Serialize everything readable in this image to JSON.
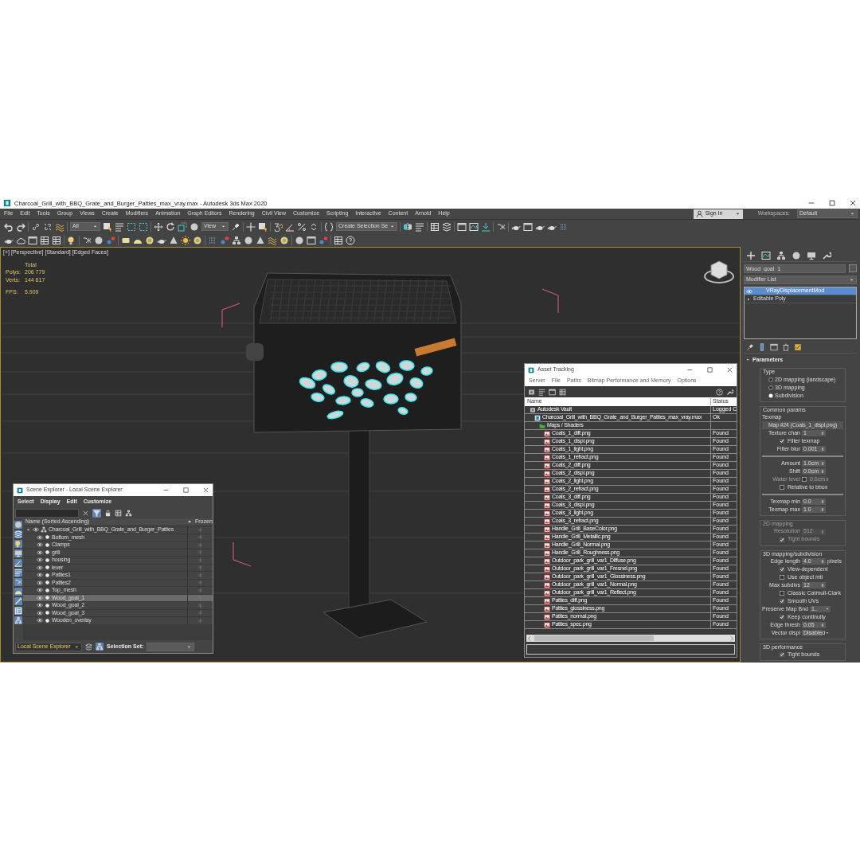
{
  "window": {
    "title": "Charcoal_Grill_with_BBQ_Grate_and_Burger_Patties_max_vray.max - Autodesk 3ds Max 2020"
  },
  "menu": [
    "File",
    "Edit",
    "Tools",
    "Group",
    "Views",
    "Create",
    "Modifiers",
    "Animation",
    "Graph Editors",
    "Rendering",
    "Civil View",
    "Customize",
    "Scripting",
    "Interactive",
    "Content",
    "Arnold",
    "Help"
  ],
  "sign_in": {
    "label": "Sign In"
  },
  "workspaces": {
    "label": "Workspaces:",
    "value": "Default"
  },
  "toolbar": {
    "selection_filter": "All",
    "reference_coord": "View",
    "named_selection": "Create Selection Se"
  },
  "viewport": {
    "labels": [
      "[+]",
      "[Perspective]",
      "[Standard]",
      "[Edged Faces]"
    ],
    "stats": {
      "header": "Total",
      "rows": [
        {
          "label": "Polys:",
          "value": "206 779"
        },
        {
          "label": "Verts:",
          "value": "144 617"
        }
      ],
      "fps_label": "FPS:",
      "fps": "5.909"
    }
  },
  "scene_explorer": {
    "title": "Scene Explorer - Local Scene Explorer",
    "menu": [
      "Select",
      "Display",
      "Edit",
      "Customize"
    ],
    "columns": [
      "Name (Sorted Ascending)",
      "Frozen"
    ],
    "root": {
      "name": "Charcoal_Grill_with_BBQ_Grate_and_Burger_Patties",
      "expanded": true,
      "selected": false,
      "children": [
        {
          "name": "Bottom_mesh",
          "selected": false
        },
        {
          "name": "Clamps",
          "selected": false
        },
        {
          "name": "grill",
          "selected": false
        },
        {
          "name": "housing",
          "selected": false
        },
        {
          "name": "lever",
          "selected": false
        },
        {
          "name": "Patties1",
          "selected": false
        },
        {
          "name": "Patties2",
          "selected": false
        },
        {
          "name": "Top_mesh",
          "selected": false
        },
        {
          "name": "Wood_goal_1",
          "selected": true
        },
        {
          "name": "Wood_goal_2",
          "selected": false
        },
        {
          "name": "Wood_goal_3",
          "selected": false
        },
        {
          "name": "Wooden_overlay",
          "selected": false
        }
      ]
    },
    "footer": {
      "explorer": "Local Scene Explorer",
      "selection_set_label": "Selection Set:"
    }
  },
  "asset_tracking": {
    "title": "Asset Tracking",
    "menu": [
      "Server",
      "File",
      "Paths",
      "Bitmap Performance and Memory",
      "Options"
    ],
    "columns": [
      "Name",
      "Status"
    ],
    "tree": [
      {
        "name": "Autodesk Vault",
        "status": "Logged C",
        "kind": "vault",
        "children": [
          {
            "name": "Charcoal_Grill_with_BBQ_Grate_and_Burger_Patties_max_vray.max",
            "status": "Ok",
            "kind": "scene",
            "children": [
              {
                "name": "Maps / Shaders",
                "kind": "folder",
                "children": [
                  {
                    "name": "Coals_1_diff.png",
                    "status": "Found",
                    "kind": "bitmap"
                  },
                  {
                    "name": "Coals_1_displ.png",
                    "status": "Found",
                    "kind": "bitmap"
                  },
                  {
                    "name": "Coals_1_light.png",
                    "status": "Found",
                    "kind": "bitmap"
                  },
                  {
                    "name": "Coals_1_refract.png",
                    "status": "Found",
                    "kind": "bitmap"
                  },
                  {
                    "name": "Coals_2_diff.png",
                    "status": "Found",
                    "kind": "bitmap"
                  },
                  {
                    "name": "Coals_2_displ.png",
                    "status": "Found",
                    "kind": "bitmap"
                  },
                  {
                    "name": "Coals_2_light.png",
                    "status": "Found",
                    "kind": "bitmap"
                  },
                  {
                    "name": "Coals_2_refract.png",
                    "status": "Found",
                    "kind": "bitmap"
                  },
                  {
                    "name": "Coals_3_diff.png",
                    "status": "Found",
                    "kind": "bitmap"
                  },
                  {
                    "name": "Coals_3_displ.png",
                    "status": "Found",
                    "kind": "bitmap"
                  },
                  {
                    "name": "Coals_3_light.png",
                    "status": "Found",
                    "kind": "bitmap"
                  },
                  {
                    "name": "Coals_3_refract.png",
                    "status": "Found",
                    "kind": "bitmap"
                  },
                  {
                    "name": "Handle_Grill_BaseColor.png",
                    "status": "Found",
                    "kind": "bitmap"
                  },
                  {
                    "name": "Handle_Grill_Metallic.png",
                    "status": "Found",
                    "kind": "bitmap"
                  },
                  {
                    "name": "Handle_Grill_Normal.png",
                    "status": "Found",
                    "kind": "bitmap"
                  },
                  {
                    "name": "Handle_Grill_Roughness.png",
                    "status": "Found",
                    "kind": "bitmap"
                  },
                  {
                    "name": "Outdoor_park_grill_var1_Diffuse.png",
                    "status": "Found",
                    "kind": "bitmap"
                  },
                  {
                    "name": "Outdoor_park_grill_var1_Fresnel.png",
                    "status": "Found",
                    "kind": "bitmap"
                  },
                  {
                    "name": "Outdoor_park_grill_var1_Glossiness.png",
                    "status": "Found",
                    "kind": "bitmap"
                  },
                  {
                    "name": "Outdoor_park_grill_var1_Normal.png",
                    "status": "Found",
                    "kind": "bitmap"
                  },
                  {
                    "name": "Outdoor_park_grill_var1_Reflect.png",
                    "status": "Found",
                    "kind": "bitmap"
                  },
                  {
                    "name": "Patties_diff.png",
                    "status": "Found",
                    "kind": "bitmap"
                  },
                  {
                    "name": "Patties_glossiness.png",
                    "status": "Found",
                    "kind": "bitmap"
                  },
                  {
                    "name": "Patties_normal.png",
                    "status": "Found",
                    "kind": "bitmap"
                  },
                  {
                    "name": "Patties_spec.png",
                    "status": "Found",
                    "kind": "bitmap"
                  }
                ]
              }
            ]
          }
        ]
      }
    ]
  },
  "command_panel": {
    "object_name": "Wood_goal_1",
    "modifier_list": "Modifier List",
    "stack": [
      {
        "name": "VRayDisplacementMod",
        "selected": true,
        "kind": "modifier"
      },
      {
        "name": "Editable Poly",
        "selected": false,
        "kind": "base"
      }
    ],
    "parameters": {
      "title": "Parameters",
      "groups": [
        {
          "title": "Type",
          "disabled": false,
          "rows": [
            {
              "kind": "radio",
              "label": "2D mapping (landscape)",
              "checked": false
            },
            {
              "kind": "radio",
              "label": "3D mapping",
              "checked": false
            },
            {
              "kind": "radio",
              "label": "Subdivision",
              "checked": true
            }
          ]
        },
        {
          "title": "Common params",
          "disabled": false,
          "rows": [
            {
              "kind": "label",
              "label": "Texmap"
            },
            {
              "kind": "button",
              "label": "Map #24 (Coals_1_displ.png)"
            },
            {
              "kind": "spinner",
              "label": "Texture chan",
              "value": "1"
            },
            {
              "kind": "checkbox",
              "label": "Filter texmap",
              "checked": true
            },
            {
              "kind": "spinner",
              "label": "Filter blur",
              "value": "0.001"
            },
            {
              "kind": "separator"
            },
            {
              "kind": "spinner",
              "label": "Amount",
              "value": "1.0cm"
            },
            {
              "kind": "spinner",
              "label": "Shift",
              "value": "0.0cm"
            },
            {
              "kind": "check_spinner",
              "label": "Water level",
              "checked": false,
              "disabled": true,
              "value": "0.0cm"
            },
            {
              "kind": "checkbox",
              "label": "Relative to bbox",
              "checked": false
            },
            {
              "kind": "separator"
            },
            {
              "kind": "spinner",
              "label": "Texmap min",
              "value": "0.0"
            },
            {
              "kind": "spinner",
              "label": "Texmap max",
              "value": "1.0"
            }
          ]
        },
        {
          "title": "2D mapping",
          "disabled": true,
          "rows": [
            {
              "kind": "spinner",
              "label": "Resolution",
              "value": "512"
            },
            {
              "kind": "checkbox",
              "label": "Tight bounds",
              "checked": true
            }
          ]
        },
        {
          "title": "3D mapping/subdivision",
          "disabled": false,
          "rows": [
            {
              "kind": "spinner",
              "label": "Edge length",
              "value": "4.0",
              "unit": "pixels"
            },
            {
              "kind": "checkbox",
              "label": "View-dependent",
              "checked": true
            },
            {
              "kind": "checkbox",
              "label": "Use object mtl",
              "checked": false
            },
            {
              "kind": "spinner",
              "label": "Max subdivs",
              "value": "12"
            },
            {
              "kind": "checkbox",
              "label": "Classic Catmull-Clark",
              "checked": false
            },
            {
              "kind": "checkbox",
              "label": "Smooth UVs",
              "checked": true
            },
            {
              "kind": "dropdown",
              "label": "Preserve Map Bnd",
              "value": "1.."
            },
            {
              "kind": "checkbox",
              "label": "Keep continuity",
              "checked": true
            },
            {
              "kind": "spinner",
              "label": "Edge thresh",
              "value": "0.05"
            },
            {
              "kind": "dropdown",
              "label": "Vector displ",
              "value": "Disabled"
            }
          ]
        },
        {
          "title": "3D performance",
          "disabled": false,
          "rows": [
            {
              "kind": "checkbox",
              "label": "Tight bounds",
              "checked": true
            }
          ]
        }
      ]
    }
  }
}
